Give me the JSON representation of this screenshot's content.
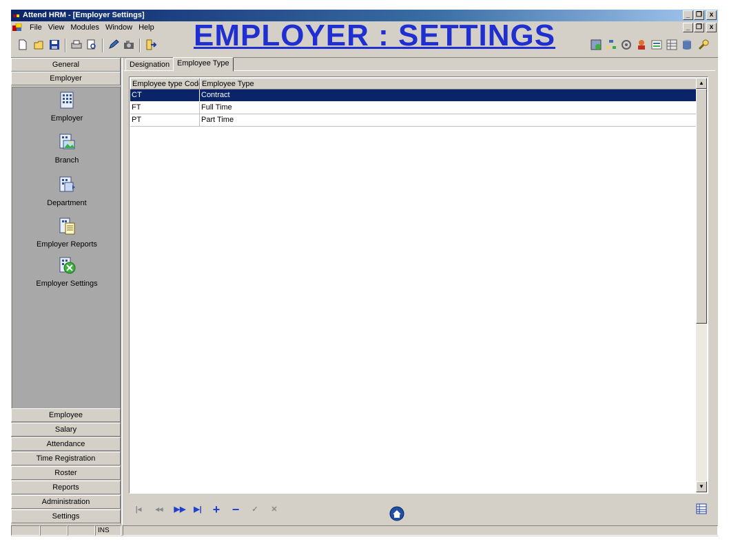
{
  "window": {
    "title": "Attend HRM - [Employer Settings]",
    "window_buttons": [
      "_",
      "̸",
      "x"
    ],
    "child_buttons": [
      "_",
      "̸",
      "x"
    ]
  },
  "menu": {
    "items": [
      "File",
      "View",
      "Modules",
      "Window",
      "Help"
    ]
  },
  "overlay_heading": "EMPLOYER : SETTINGS",
  "toolbar": {
    "left_icons": [
      "new-icon",
      "open-icon",
      "save-icon",
      "print-icon",
      "print-preview-icon",
      "edit-icon",
      "camera-icon",
      "exit-icon"
    ],
    "right_icons": [
      "employer-icon",
      "org-chart-icon",
      "settings-icon",
      "employee-icon",
      "attendance-icon",
      "roster-icon",
      "database-icon",
      "tools-icon"
    ]
  },
  "left_nav": {
    "top_sections": [
      "General",
      "Employer"
    ],
    "items": [
      {
        "label": "Employer",
        "icon": "building-icon"
      },
      {
        "label": "Branch",
        "icon": "branch-icon"
      },
      {
        "label": "Department",
        "icon": "department-icon"
      },
      {
        "label": "Employer Reports",
        "icon": "employer-reports-icon"
      },
      {
        "label": "Employer Settings",
        "icon": "employer-settings-icon"
      }
    ],
    "bottom_sections": [
      "Employee",
      "Salary",
      "Attendance",
      "Time Registration",
      "Roster",
      "Reports",
      "Administration",
      "Settings"
    ]
  },
  "tabs": [
    {
      "label": "Designation",
      "active": false
    },
    {
      "label": "Employee Type",
      "active": true
    }
  ],
  "grid": {
    "columns": [
      "Employee type Code",
      "Employee Type"
    ],
    "rows": [
      {
        "code": "CT",
        "type": "Contract",
        "selected": true
      },
      {
        "code": "FT",
        "type": "Full Time",
        "selected": false
      },
      {
        "code": "PT",
        "type": "Part Time",
        "selected": false
      }
    ]
  },
  "navigator": {
    "buttons": [
      {
        "name": "first-record-button",
        "glyph": "|◂"
      },
      {
        "name": "prior-record-button",
        "glyph": "◂◂"
      },
      {
        "name": "next-record-button",
        "glyph": "▶▶"
      },
      {
        "name": "last-record-button",
        "glyph": "▶|"
      },
      {
        "name": "insert-record-button",
        "glyph": "+"
      },
      {
        "name": "delete-record-button",
        "glyph": "−"
      },
      {
        "name": "post-record-button",
        "glyph": "✓"
      },
      {
        "name": "cancel-record-button",
        "glyph": "✕"
      }
    ]
  },
  "statusbar": {
    "ins_label": "INS"
  },
  "colors": {
    "titlebar": "#0a246a",
    "selection": "#0a246a",
    "heading": "#1f2fd0",
    "panel": "#d4d0c8",
    "nav_area": "#a8a8a8"
  }
}
